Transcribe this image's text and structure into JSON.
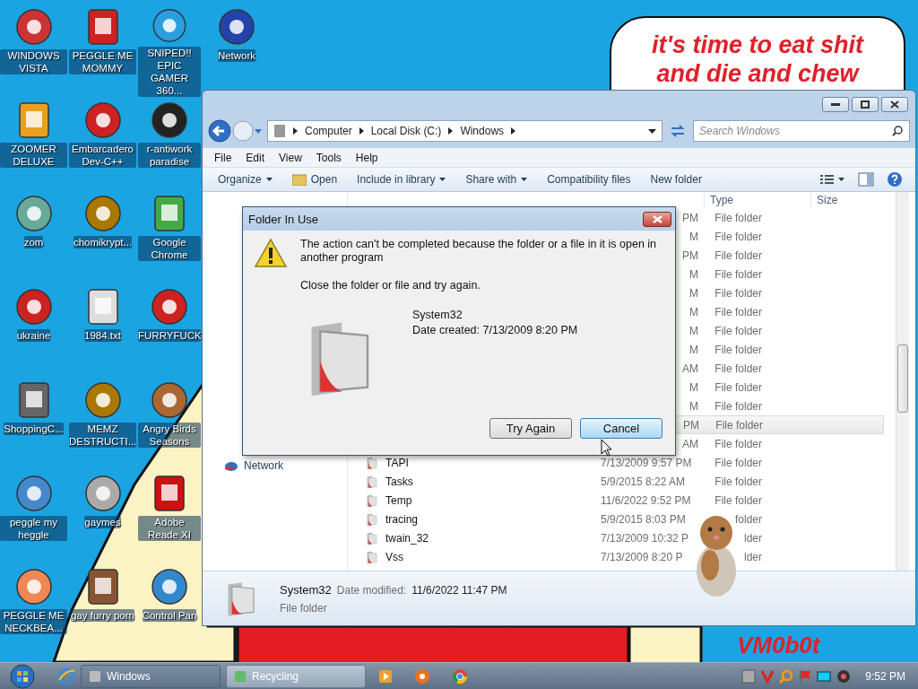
{
  "wallpaper": {
    "bubble_lines": [
      "it's time to eat shit",
      "and die and chew"
    ],
    "signature": "VM0b0t"
  },
  "desktop_icons": [
    {
      "label": "WINDOWS VISTA"
    },
    {
      "label": "ZOOMER DELUXE"
    },
    {
      "label": "zom"
    },
    {
      "label": "ukraine"
    },
    {
      "label": "ShoppingC..."
    },
    {
      "label": "peggle my heggle"
    },
    {
      "label": "PEGGLE ME NECKBEA..."
    },
    {
      "label": "PEGGLE ME MOMMY"
    },
    {
      "label": "Embarcadero Dev-C++"
    },
    {
      "label": "chomikrypt..."
    },
    {
      "label": "1984.txt"
    },
    {
      "label": "MEMZ DESTRUCTI..."
    },
    {
      "label": "gaymes"
    },
    {
      "label": "gay furry porn"
    },
    {
      "label": "SNIPED!! EPIC GAMER 360..."
    },
    {
      "label": "r-antiwork paradise"
    },
    {
      "label": "Google Chrome"
    },
    {
      "label": "FURRYFUCK"
    },
    {
      "label": "Angry Birds Seasons"
    },
    {
      "label": "Adobe Reade XI"
    },
    {
      "label": "Control Pan"
    },
    {
      "label": "Network"
    }
  ],
  "explorer": {
    "address": [
      "Computer",
      "Local Disk (C:)",
      "Windows"
    ],
    "search": {
      "placeholder": "Search Windows"
    },
    "menu": [
      "File",
      "Edit",
      "View",
      "Tools",
      "Help"
    ],
    "toolbar": [
      {
        "label": "Organize",
        "kind": "dropdown"
      },
      {
        "label": "Open",
        "kind": "icon"
      },
      {
        "label": "Include in library",
        "kind": "dropdown"
      },
      {
        "label": "Share with",
        "kind": "dropdown"
      },
      {
        "label": "Compatibility files",
        "kind": "plain"
      },
      {
        "label": "New folder",
        "kind": "plain"
      }
    ],
    "nav": [
      {
        "label": "Network"
      }
    ],
    "columns": [
      "Type",
      "Size"
    ],
    "rows": [
      {
        "date": "PM",
        "type": "File folder",
        "selected": false
      },
      {
        "date": "M",
        "type": "File folder",
        "selected": false
      },
      {
        "date": "PM",
        "type": "File folder",
        "selected": false
      },
      {
        "date": "M",
        "type": "File folder",
        "selected": false
      },
      {
        "date": "M",
        "type": "File folder",
        "selected": false
      },
      {
        "date": "M",
        "type": "File folder",
        "selected": false
      },
      {
        "date": "M",
        "type": "File folder",
        "selected": false
      },
      {
        "date": "M",
        "type": "File folder",
        "selected": false
      },
      {
        "date": "AM",
        "type": "File folder",
        "selected": false
      },
      {
        "date": "M",
        "type": "File folder",
        "selected": false
      },
      {
        "date": "M",
        "type": "File folder",
        "selected": false
      },
      {
        "date": "PM",
        "type": "File folder",
        "selected": true
      },
      {
        "date": "AM",
        "type": "File folder",
        "selected": false
      },
      {
        "name": "TAPI",
        "date": "7/13/2009 9:57 PM",
        "type": "File folder",
        "selected": false
      },
      {
        "name": "Tasks",
        "date": "5/9/2015 8:22 AM",
        "type": "File folder",
        "selected": false
      },
      {
        "name": "Temp",
        "date": "11/6/2022 9:52 PM",
        "type": "File folder",
        "selected": false
      },
      {
        "name": "tracing",
        "date": "5/9/2015 8:03 PM",
        "type": "folder",
        "selected": false
      },
      {
        "name": "twain_32",
        "date": "7/13/2009 10:32 P",
        "type": "lder",
        "selected": false
      },
      {
        "name": "Vss",
        "date": "7/13/2009 8:20 P",
        "type": "lder",
        "selected": false
      }
    ],
    "details": {
      "name": "System32",
      "date_label": "Date modified:",
      "date": "11/6/2022 11:47 PM",
      "type": "File folder"
    }
  },
  "dialog": {
    "title": "Folder In Use",
    "message": "The action can't be completed because the folder or a file in it is open in another program",
    "hint": "Close the folder or file and try again.",
    "item_name": "System32",
    "item_date": "Date created: 7/13/2009 8:20 PM",
    "buttons": [
      {
        "label": "Try Again",
        "highlighted": false
      },
      {
        "label": "Cancel",
        "highlighted": true
      }
    ]
  },
  "taskbar": {
    "tasks": [
      {
        "label": "Windows",
        "selected": true
      },
      {
        "label": "Recycling",
        "selected": false
      }
    ],
    "clock": "9:52 PM"
  }
}
